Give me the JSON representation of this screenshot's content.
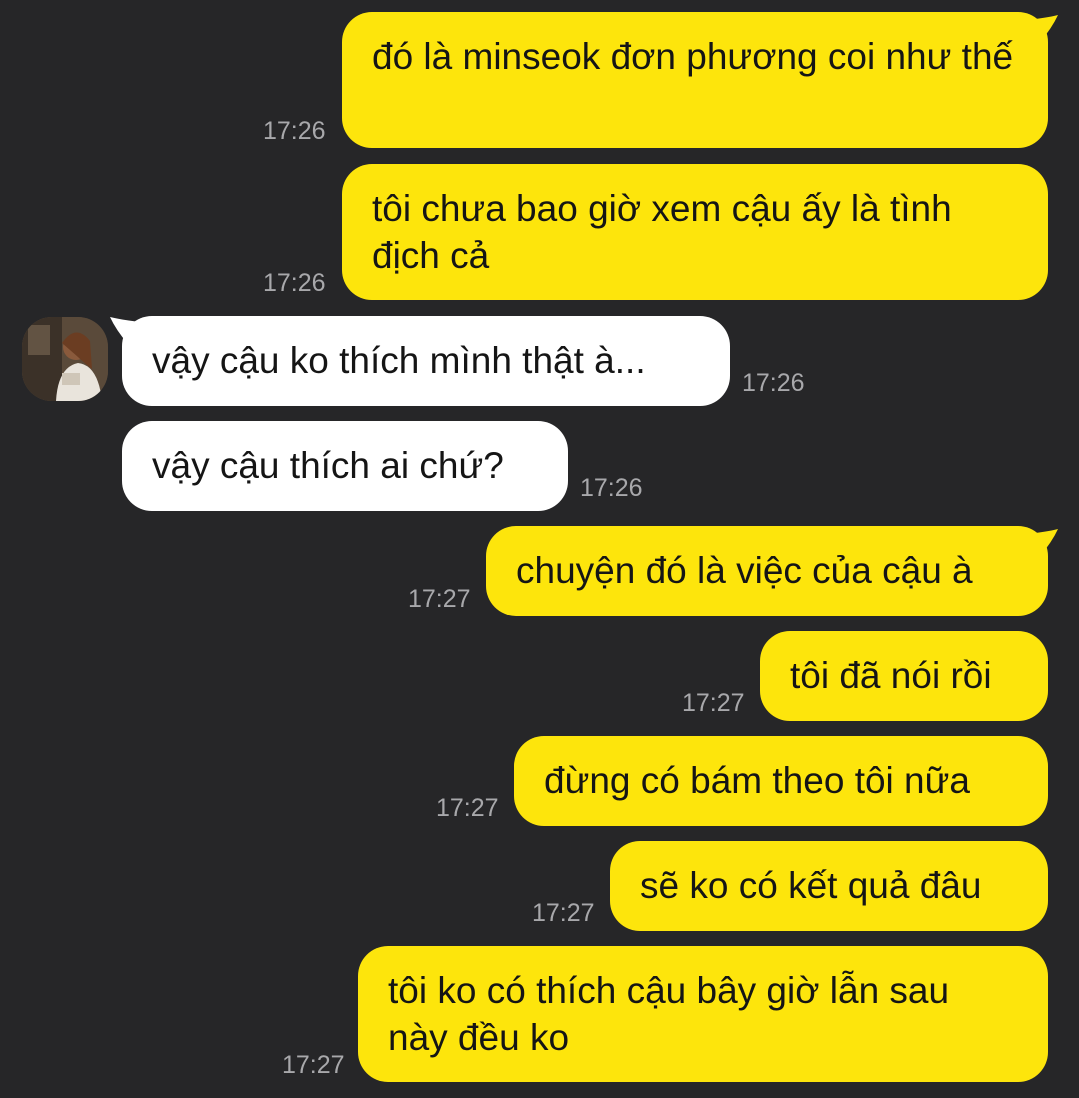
{
  "colors": {
    "background": "#262628",
    "sent_bubble": "#fde50c",
    "received_bubble": "#ffffff",
    "message_text": "#151515",
    "timestamp": "#a8a8ab"
  },
  "contact": {
    "avatar_icon": "profile-photo-icon"
  },
  "messages": [
    {
      "sender": "me",
      "text": "đó là minseok đơn phương coi như thế",
      "time": "17:26"
    },
    {
      "sender": "me",
      "text": "tôi chưa bao giờ xem cậu ấy là tình địch cả",
      "time": "17:26"
    },
    {
      "sender": "them",
      "text": "vậy cậu ko thích mình thật à...",
      "time": "17:26"
    },
    {
      "sender": "them",
      "text": "vậy cậu thích ai chứ?",
      "time": "17:26"
    },
    {
      "sender": "me",
      "text": "chuyện đó là việc của cậu à",
      "time": "17:27"
    },
    {
      "sender": "me",
      "text": "tôi đã nói rồi",
      "time": "17:27"
    },
    {
      "sender": "me",
      "text": "đừng có bám theo tôi nữa",
      "time": "17:27"
    },
    {
      "sender": "me",
      "text": "sẽ ko có kết quả đâu",
      "time": "17:27"
    },
    {
      "sender": "me",
      "text": "tôi ko có thích cậu bây giờ lẫn sau này đều ko",
      "time": "17:27"
    }
  ]
}
